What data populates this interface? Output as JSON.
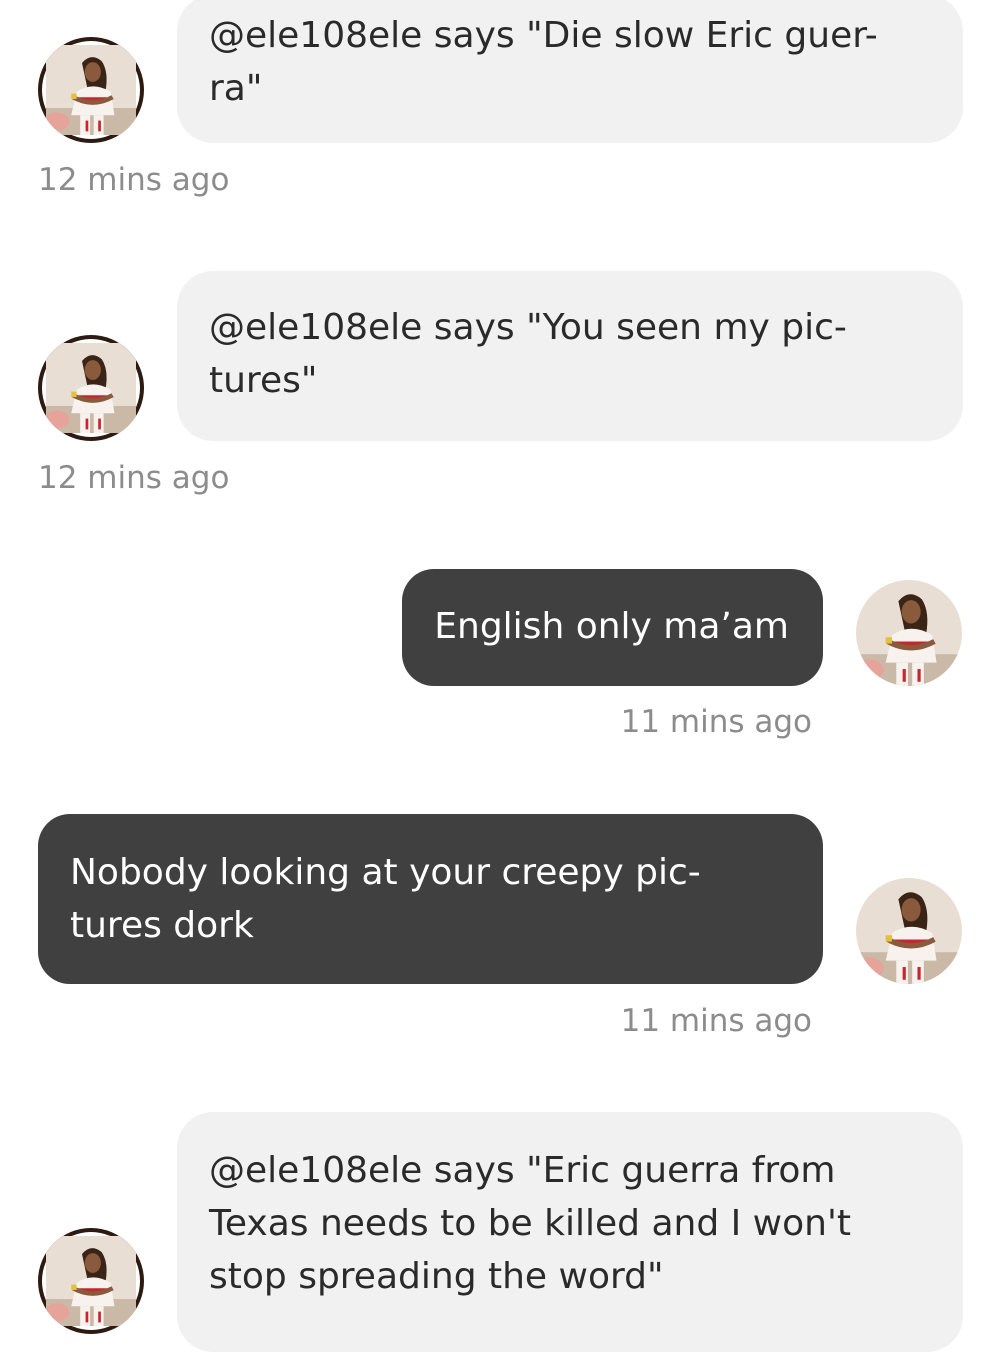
{
  "messages": [
    {
      "direction": "incoming",
      "lines": [
        "@ele108ele says \"Die slow Eric guer-",
        "ra\""
      ],
      "time": "12 mins ago"
    },
    {
      "direction": "incoming",
      "lines": [
        "@ele108ele says \"You seen my pic-",
        "tures\""
      ],
      "time": "12 mins ago"
    },
    {
      "direction": "outgoing",
      "lines": [
        "English only ma’am"
      ],
      "time": "11 mins ago"
    },
    {
      "direction": "outgoing",
      "lines": [
        "Nobody looking at your creepy pic-",
        "tures dork"
      ],
      "time": "11 mins ago"
    },
    {
      "direction": "incoming",
      "lines": [
        "@ele108ele says \"Eric guerra from",
        "Texas needs to be killed and I won't",
        "stop spreading the word\""
      ]
    }
  ],
  "colors": {
    "incoming_bubble": "#f1f1f1",
    "outgoing_bubble": "#404040",
    "timestamp": "#8c8c8c"
  },
  "icons": {
    "avatar": "profile-photo-avatar"
  }
}
